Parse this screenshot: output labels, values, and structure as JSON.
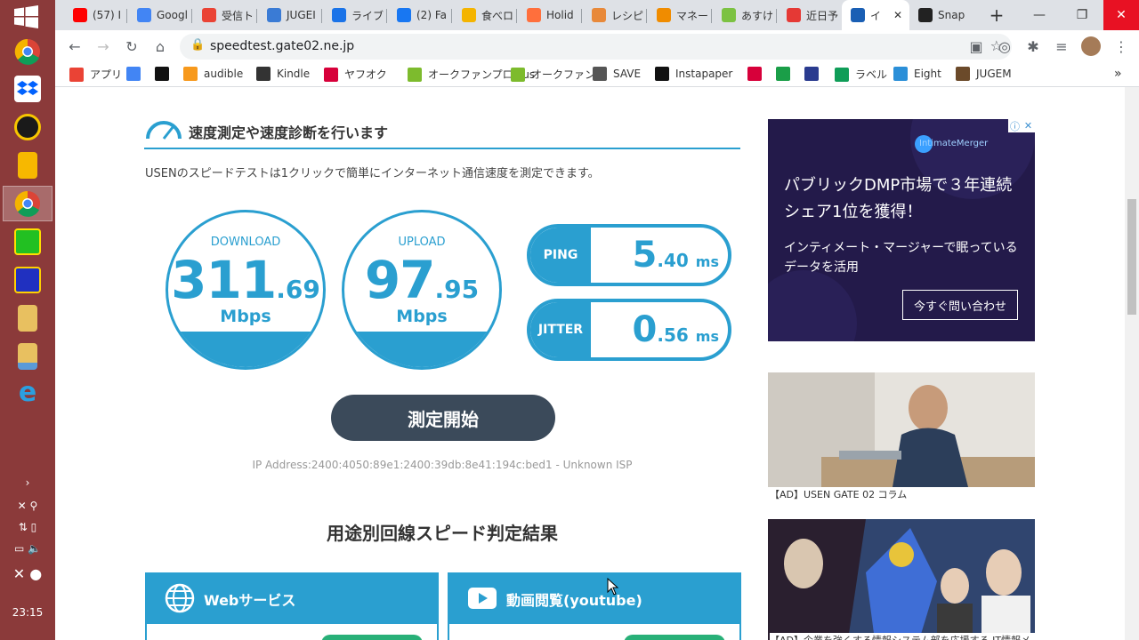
{
  "taskbar": {
    "clock": "23:15",
    "apps": [
      {
        "name": "chrome"
      },
      {
        "name": "dropbox"
      },
      {
        "name": "norton"
      },
      {
        "name": "keep"
      },
      {
        "name": "chrome-active"
      },
      {
        "name": "app-green"
      },
      {
        "name": "app-puzzle"
      },
      {
        "name": "folder"
      },
      {
        "name": "folder-2"
      },
      {
        "name": "internet-explorer"
      }
    ]
  },
  "browser": {
    "tabs": [
      {
        "label": "(57) I",
        "color": "#ff0000"
      },
      {
        "label": "Googl",
        "color": "#4285f4"
      },
      {
        "label": "受信ト",
        "color": "#ea4335"
      },
      {
        "label": "JUGEI",
        "color": "#3a7bd5"
      },
      {
        "label": "ライブト",
        "color": "#1a73e8"
      },
      {
        "label": "(2) Fa",
        "color": "#1877f2"
      },
      {
        "label": "食べロ",
        "color": "#f4b400"
      },
      {
        "label": "Holid",
        "color": "#ff6f3c"
      },
      {
        "label": "レシピ",
        "color": "#e8893a"
      },
      {
        "label": "マネー",
        "color": "#f08c00"
      },
      {
        "label": "あすけ",
        "color": "#7cc242"
      },
      {
        "label": "近日予",
        "color": "#e53935"
      },
      {
        "label": "イ",
        "color": "#1a5fb4"
      },
      {
        "label": "Snap",
        "color": "#222222"
      }
    ],
    "url": "speedtest.gate02.ne.jp",
    "bookmarks": [
      {
        "label": "アプリ",
        "color": "#ea4335"
      },
      {
        "label": "",
        "color": "#4285f4"
      },
      {
        "label": "",
        "color": "#111111"
      },
      {
        "label": "audible",
        "color": "#f7991c"
      },
      {
        "label": "Kindle",
        "color": "#333333"
      },
      {
        "label": "ヤフオク",
        "color": "#d7003a"
      },
      {
        "label": "オークファンプロPlus",
        "color": "#7dbb2d"
      },
      {
        "label": "オークファン",
        "color": "#7dbb2d"
      },
      {
        "label": "SAVE",
        "color": "#555555"
      },
      {
        "label": "Instapaper",
        "color": "#111111"
      },
      {
        "label": "",
        "color": "#d7003a"
      },
      {
        "label": "",
        "color": "#1a9e48"
      },
      {
        "label": "",
        "color": "#2a3b8f"
      },
      {
        "label": "ラベル",
        "color": "#0f9d58"
      },
      {
        "label": "Eight",
        "color": "#2b8fd8"
      },
      {
        "label": "JUGEM",
        "color": "#6b4a2a"
      }
    ]
  },
  "page": {
    "section_title": "速度測定や速度診断を行います",
    "description": "USENのスピードテストは1クリックで簡単にインターネット通信速度を測定できます。",
    "download": {
      "label": "DOWNLOAD",
      "int": "311",
      "dec": ".69",
      "unit": "Mbps"
    },
    "upload": {
      "label": "UPLOAD",
      "int": "97",
      "dec": ".95",
      "unit": "Mbps"
    },
    "ping": {
      "label": "PING",
      "int": "5",
      "dec": ".40",
      "unit": "ms"
    },
    "jitter": {
      "label": "JITTER",
      "int": "0",
      "dec": ".56",
      "unit": "ms"
    },
    "start_button": "測定開始",
    "ip_line": "IP Address:2400:4050:89e1:2400:39db:8e41:194c:bed1 - Unknown ISP",
    "results_heading": "用途別回線スピード判定結果",
    "cards": [
      {
        "title": "Webサービス"
      },
      {
        "title": "動画閲覧(youtube)"
      }
    ]
  },
  "ads": {
    "ad1_brand": "IntimateMerger",
    "ad1_headline": "パブリックDMP市場で３年連続シェア1位を獲得！",
    "ad1_sub": "インティメート・マージャーで眠っているデータを活用",
    "ad1_cta": "今すぐ問い合わせ",
    "ad2_caption": "【AD】USEN GATE 02 コラム",
    "ad3_caption": "【AD】企業を強くする情報システム部を応援する IT情報メディア「JOSHIGUMAN"
  },
  "colors": {
    "accent": "#2a9fd0",
    "button": "#3b4a5a",
    "taskbar": "#8b3a3a"
  }
}
